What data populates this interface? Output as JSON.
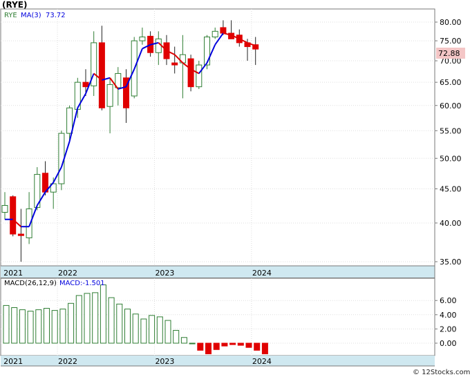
{
  "title": "(RYE)",
  "watermark": "© 12Stocks.com",
  "chart_data": [
    {
      "type": "candlestick",
      "name": "price",
      "legend": {
        "symbol": "RYE",
        "ma_label": "MA(3)",
        "ma_value": "73.72"
      },
      "last_price": "72.88",
      "colors": {
        "up": "#2e7d32",
        "down": "#e00000",
        "ma_rising": "#0000dd",
        "ma_falling": "#dd0000",
        "badge_bg": "#f4c6c6"
      },
      "y_axis": {
        "scale": "log",
        "ticks": [
          35,
          40,
          45,
          50,
          55,
          60,
          65,
          70,
          75,
          80
        ],
        "tick_labels": [
          "35.00",
          "40.00",
          "45.00",
          "50.00",
          "55.00",
          "60.00",
          "65.00",
          "70.00",
          "75.00",
          "80.00"
        ]
      },
      "x_axis": {
        "labels": [
          "2021",
          "2022",
          "2023",
          "2024"
        ],
        "label_bar_index": [
          0,
          7,
          19,
          31
        ]
      },
      "candles": [
        {
          "o": 41.5,
          "h": 44.5,
          "l": 40.5,
          "c": 42.5
        },
        {
          "o": 43.8,
          "h": 44.0,
          "l": 38.2,
          "c": 38.5
        },
        {
          "o": 38.5,
          "h": 42.0,
          "l": 35.0,
          "c": 38.3
        },
        {
          "o": 38.0,
          "h": 44.5,
          "l": 37.2,
          "c": 42.0
        },
        {
          "o": 42.2,
          "h": 48.5,
          "l": 41.8,
          "c": 47.3
        },
        {
          "o": 47.5,
          "h": 49.5,
          "l": 44.0,
          "c": 44.5
        },
        {
          "o": 44.5,
          "h": 46.8,
          "l": 42.0,
          "c": 45.8
        },
        {
          "o": 45.8,
          "h": 55.0,
          "l": 44.8,
          "c": 54.5
        },
        {
          "o": 54.5,
          "h": 60.0,
          "l": 53.0,
          "c": 59.5
        },
        {
          "o": 59.2,
          "h": 66.0,
          "l": 57.5,
          "c": 65.0
        },
        {
          "o": 65.0,
          "h": 68.0,
          "l": 62.0,
          "c": 64.0
        },
        {
          "o": 64.2,
          "h": 77.5,
          "l": 62.0,
          "c": 74.5
        },
        {
          "o": 74.5,
          "h": 79.0,
          "l": 59.0,
          "c": 59.5
        },
        {
          "o": 59.8,
          "h": 66.0,
          "l": 54.5,
          "c": 64.5
        },
        {
          "o": 63.8,
          "h": 68.5,
          "l": 60.0,
          "c": 67.0
        },
        {
          "o": 66.0,
          "h": 68.0,
          "l": 56.5,
          "c": 59.5
        },
        {
          "o": 62.0,
          "h": 76.0,
          "l": 61.5,
          "c": 75.0
        },
        {
          "o": 75.0,
          "h": 78.5,
          "l": 74.0,
          "c": 76.0
        },
        {
          "o": 76.2,
          "h": 77.5,
          "l": 71.0,
          "c": 72.0
        },
        {
          "o": 72.0,
          "h": 77.5,
          "l": 69.0,
          "c": 75.5
        },
        {
          "o": 74.5,
          "h": 76.5,
          "l": 69.0,
          "c": 70.5
        },
        {
          "o": 69.5,
          "h": 73.5,
          "l": 67.0,
          "c": 69.0
        },
        {
          "o": 69.5,
          "h": 76.5,
          "l": 61.5,
          "c": 71.5
        },
        {
          "o": 70.5,
          "h": 71.5,
          "l": 63.0,
          "c": 64.0
        },
        {
          "o": 64.0,
          "h": 70.0,
          "l": 63.5,
          "c": 69.0
        },
        {
          "o": 69.0,
          "h": 76.5,
          "l": 68.0,
          "c": 76.0
        },
        {
          "o": 76.0,
          "h": 78.5,
          "l": 75.5,
          "c": 77.5
        },
        {
          "o": 78.5,
          "h": 80.5,
          "l": 76.5,
          "c": 77.0
        },
        {
          "o": 77.0,
          "h": 80.5,
          "l": 75.5,
          "c": 75.5
        },
        {
          "o": 76.5,
          "h": 78.0,
          "l": 73.5,
          "c": 74.5
        },
        {
          "o": 74.5,
          "h": 75.5,
          "l": 70.0,
          "c": 73.5
        },
        {
          "o": 74.0,
          "h": 76.0,
          "l": 69.0,
          "c": 72.88
        }
      ],
      "ma": [
        40.5,
        40.5,
        39.5,
        39.5,
        42.5,
        44.5,
        46.0,
        48.5,
        53.0,
        59.5,
        62.5,
        67.0,
        65.5,
        66.0,
        63.5,
        64.0,
        68.0,
        73.0,
        74.0,
        74.5,
        72.5,
        71.5,
        69.5,
        68.0,
        67.0,
        69.5,
        74.0,
        77.0,
        76.5,
        75.5,
        74.5,
        73.72
      ]
    },
    {
      "type": "bar",
      "name": "macd",
      "legend": {
        "label": "MACD(26,12,9)",
        "value_label": "MACD:-1.501"
      },
      "y_axis": {
        "ticks": [
          0,
          2,
          4,
          6
        ],
        "tick_labels": [
          "0.00",
          "2.00",
          "4.00",
          "6.00"
        ]
      },
      "x_axis": {
        "labels": [
          "2021",
          "2022",
          "2023",
          "2024"
        ],
        "label_bar_index": [
          0,
          7,
          19,
          31
        ]
      },
      "values": [
        5.3,
        5.0,
        4.7,
        4.5,
        4.7,
        4.9,
        4.6,
        4.8,
        5.6,
        6.7,
        7.0,
        7.1,
        8.2,
        6.4,
        5.5,
        4.8,
        4.1,
        3.4,
        3.9,
        3.7,
        3.2,
        1.8,
        0.8,
        0.0,
        -1.0,
        -1.5,
        -0.9,
        -0.4,
        -0.2,
        -0.3,
        -0.6,
        -1.0,
        -1.501
      ]
    }
  ]
}
